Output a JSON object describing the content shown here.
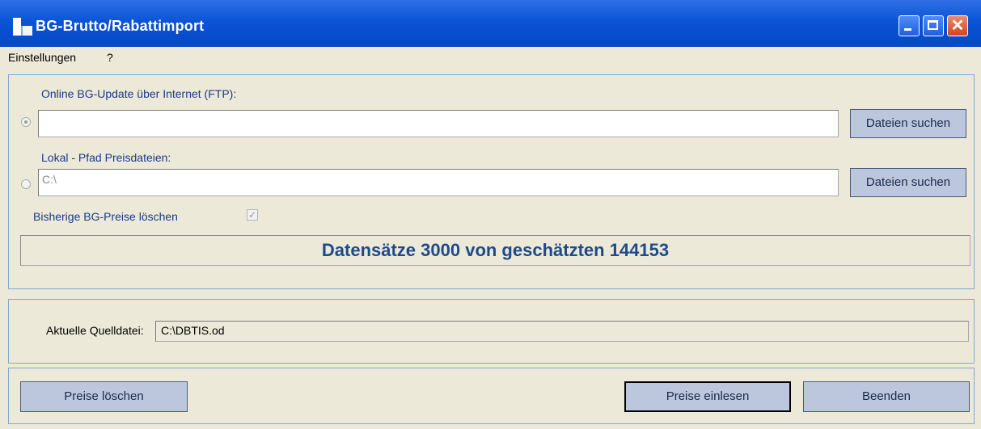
{
  "window": {
    "title": "BG-Brutto/Rabattimport",
    "minimize_icon": "minimize-icon",
    "maximize_icon": "maximize-icon",
    "close_icon": "close-icon",
    "close_glyph": "✕"
  },
  "menu": {
    "items": [
      {
        "label": "Einstellungen"
      },
      {
        "label": "?"
      }
    ]
  },
  "online": {
    "label": "Online BG-Update über Internet (FTP):",
    "value": "",
    "button": "Dateien suchen",
    "selected": true
  },
  "local": {
    "label": "Lokal - Pfad Preisdateien:",
    "value": "C:\\",
    "button": "Dateien suchen",
    "selected": false
  },
  "delete_prices": {
    "label": "Bisherige BG-Preise löschen",
    "checked": true,
    "check_glyph": "✓"
  },
  "status": {
    "text": "Datensätze 3000 von geschätzten 144153"
  },
  "source": {
    "label": "Aktuelle Quelldatei:",
    "value": "C:\\DBTIS.od"
  },
  "footer": {
    "delete_button": "Preise löschen",
    "import_button": "Preise einlesen",
    "quit_button": "Beenden"
  },
  "colors": {
    "titlebar": "#0a54d6",
    "background": "#ece9d8",
    "label_blue": "#1a3a8a",
    "status_text": "#1f4a8a",
    "button_bg": "#bcc7dd",
    "panel_border": "#7fa9d6"
  }
}
